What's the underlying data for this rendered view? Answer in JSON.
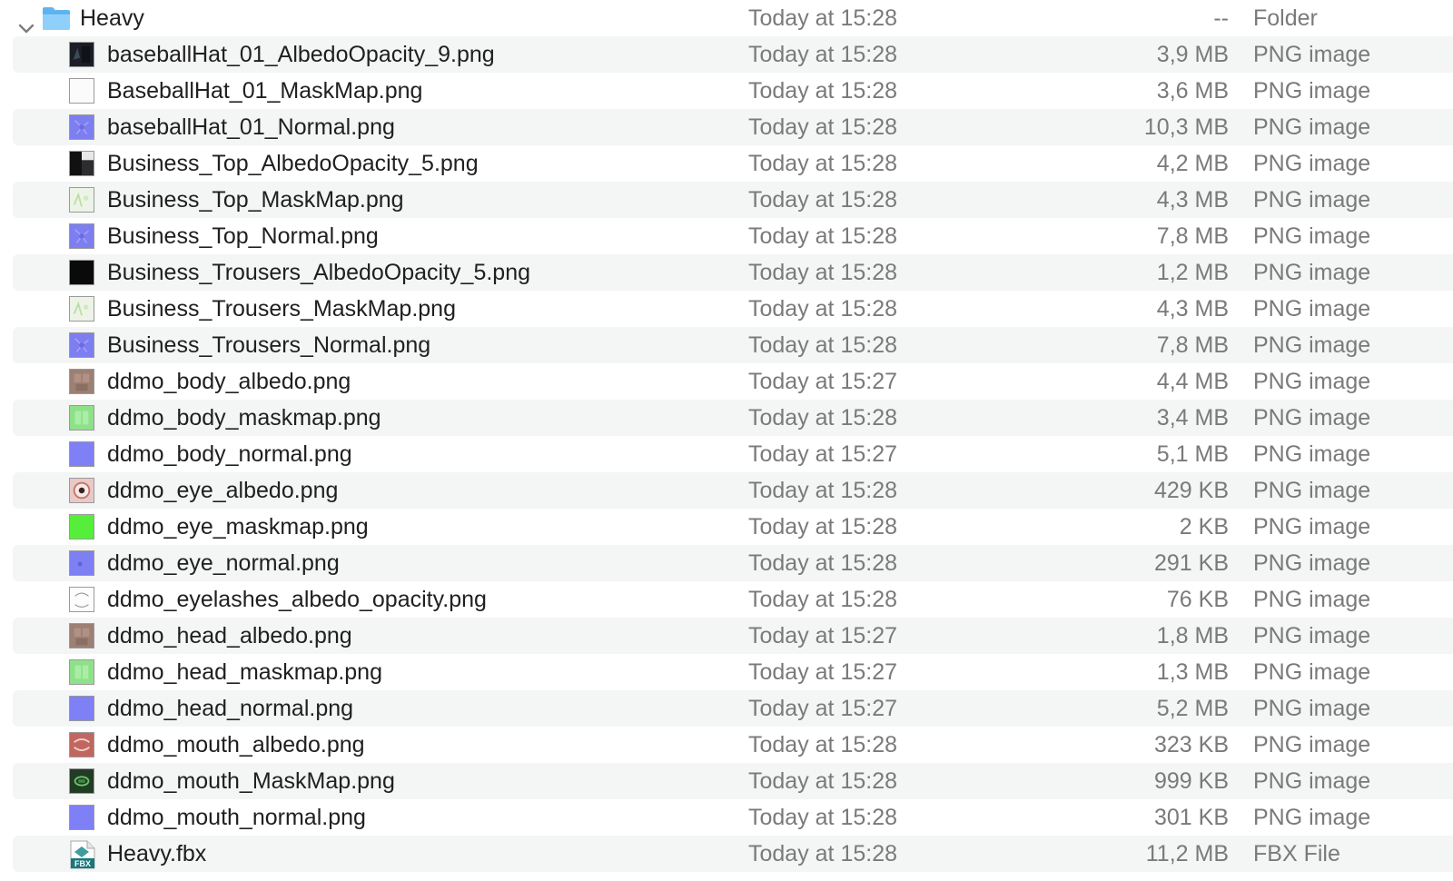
{
  "folder": {
    "name": "Heavy",
    "date": "Today at 15:28",
    "size": "--",
    "kind": "Folder",
    "expanded_icon": "chevron-down-icon",
    "icon": "folder-icon"
  },
  "files": [
    {
      "name": "baseballHat_01_AlbedoOpacity_9.png",
      "date": "Today at 15:28",
      "size": "3,9 MB",
      "kind": "PNG image",
      "thumb": "dark-albedo"
    },
    {
      "name": "BaseballHat_01_MaskMap.png",
      "date": "Today at 15:28",
      "size": "3,6 MB",
      "kind": "PNG image",
      "thumb": "white-mask"
    },
    {
      "name": "baseballHat_01_Normal.png",
      "date": "Today at 15:28",
      "size": "10,3 MB",
      "kind": "PNG image",
      "thumb": "normal-map"
    },
    {
      "name": "Business_Top_AlbedoOpacity_5.png",
      "date": "Today at 15:28",
      "size": "4,2 MB",
      "kind": "PNG image",
      "thumb": "dark-split"
    },
    {
      "name": "Business_Top_MaskMap.png",
      "date": "Today at 15:28",
      "size": "4,3 MB",
      "kind": "PNG image",
      "thumb": "light-mask"
    },
    {
      "name": "Business_Top_Normal.png",
      "date": "Today at 15:28",
      "size": "7,8 MB",
      "kind": "PNG image",
      "thumb": "normal-map"
    },
    {
      "name": "Business_Trousers_AlbedoOpacity_5.png",
      "date": "Today at 15:28",
      "size": "1,2 MB",
      "kind": "PNG image",
      "thumb": "black"
    },
    {
      "name": "Business_Trousers_MaskMap.png",
      "date": "Today at 15:28",
      "size": "4,3 MB",
      "kind": "PNG image",
      "thumb": "light-mask"
    },
    {
      "name": "Business_Trousers_Normal.png",
      "date": "Today at 15:28",
      "size": "7,8 MB",
      "kind": "PNG image",
      "thumb": "normal-map"
    },
    {
      "name": "ddmo_body_albedo.png",
      "date": "Today at 15:27",
      "size": "4,4 MB",
      "kind": "PNG image",
      "thumb": "skin"
    },
    {
      "name": "ddmo_body_maskmap.png",
      "date": "Today at 15:28",
      "size": "3,4 MB",
      "kind": "PNG image",
      "thumb": "green-mask"
    },
    {
      "name": "ddmo_body_normal.png",
      "date": "Today at 15:27",
      "size": "5,1 MB",
      "kind": "PNG image",
      "thumb": "normal-flat"
    },
    {
      "name": "ddmo_eye_albedo.png",
      "date": "Today at 15:28",
      "size": "429 KB",
      "kind": "PNG image",
      "thumb": "eye"
    },
    {
      "name": "ddmo_eye_maskmap.png",
      "date": "Today at 15:28",
      "size": "2 KB",
      "kind": "PNG image",
      "thumb": "green-solid"
    },
    {
      "name": "ddmo_eye_normal.png",
      "date": "Today at 15:28",
      "size": "291 KB",
      "kind": "PNG image",
      "thumb": "normal-dot"
    },
    {
      "name": "ddmo_eyelashes_albedo_opacity.png",
      "date": "Today at 15:28",
      "size": "76 KB",
      "kind": "PNG image",
      "thumb": "lashes"
    },
    {
      "name": "ddmo_head_albedo.png",
      "date": "Today at 15:27",
      "size": "1,8 MB",
      "kind": "PNG image",
      "thumb": "skin"
    },
    {
      "name": "ddmo_head_maskmap.png",
      "date": "Today at 15:27",
      "size": "1,3 MB",
      "kind": "PNG image",
      "thumb": "green-mask"
    },
    {
      "name": "ddmo_head_normal.png",
      "date": "Today at 15:27",
      "size": "5,2 MB",
      "kind": "PNG image",
      "thumb": "normal-flat"
    },
    {
      "name": "ddmo_mouth_albedo.png",
      "date": "Today at 15:28",
      "size": "323 KB",
      "kind": "PNG image",
      "thumb": "mouth"
    },
    {
      "name": "ddmo_mouth_MaskMap.png",
      "date": "Today at 15:28",
      "size": "999 KB",
      "kind": "PNG image",
      "thumb": "mouth-mask"
    },
    {
      "name": "ddmo_mouth_normal.png",
      "date": "Today at 15:28",
      "size": "301 KB",
      "kind": "PNG image",
      "thumb": "normal-flat"
    },
    {
      "name": "Heavy.fbx",
      "date": "Today at 15:28",
      "size": "11,2 MB",
      "kind": "FBX File",
      "thumb": "fbx-document",
      "badge": "FBX"
    }
  ]
}
